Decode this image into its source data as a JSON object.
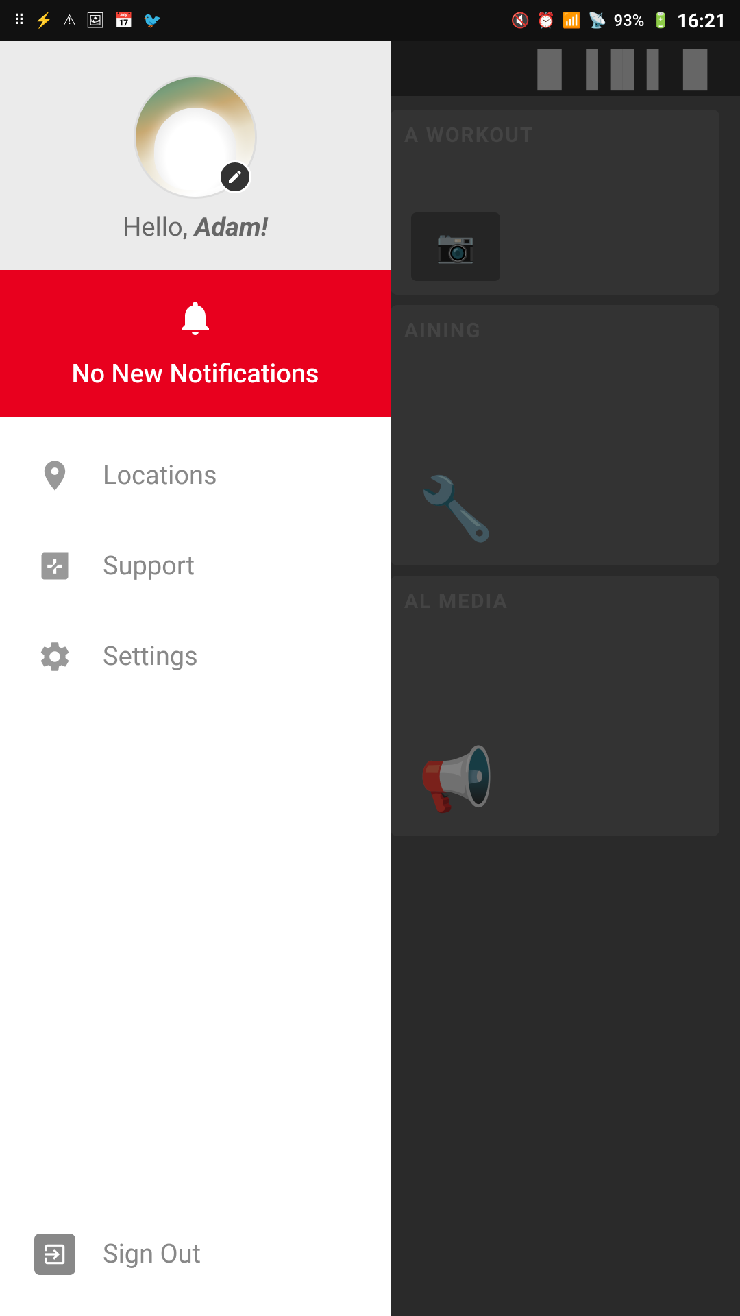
{
  "statusBar": {
    "time": "16:21",
    "battery": "93%"
  },
  "profile": {
    "greeting_static": "Hello, ",
    "greeting_name": "Adam!",
    "greeting_full": "Hello, Adam!"
  },
  "notification": {
    "text": "No New Notifications"
  },
  "menu": {
    "locations_label": "Locations",
    "support_label": "Support",
    "settings_label": "Settings"
  },
  "signout": {
    "label": "Sign Out"
  },
  "background": {
    "workout_label": "A WORKOUT",
    "training_label": "AINING",
    "social_label": "AL MEDIA"
  }
}
